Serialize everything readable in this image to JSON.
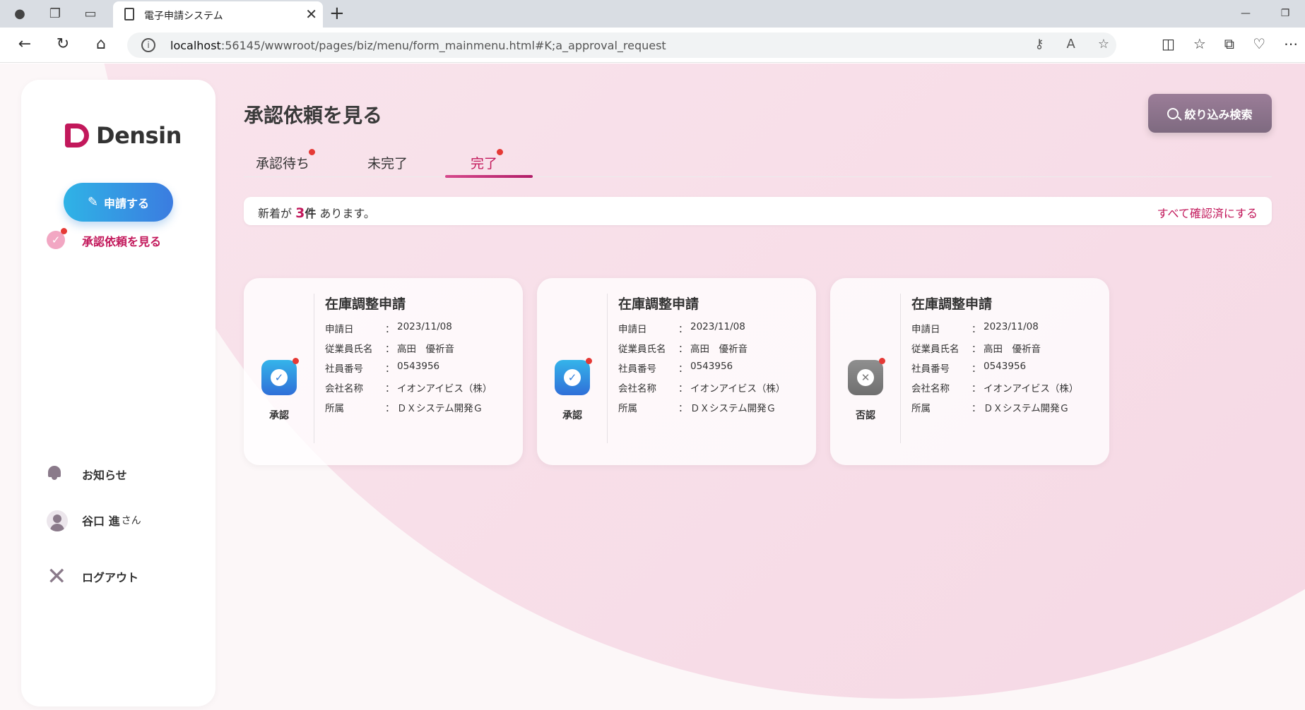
{
  "browser": {
    "tab_title": "電子申請システム",
    "url_host": "localhost",
    "url_rest": ":56145/wwwroot/pages/biz/menu/form_mainmenu.html#K;a_approval_request"
  },
  "sidebar": {
    "logo_text": "Densin",
    "apply_button": "申請する",
    "nav_approval": "承認依頼を見る",
    "notifications": "お知らせ",
    "user_name": "谷口 進",
    "user_suffix": "さん",
    "logout": "ログアウト"
  },
  "main": {
    "title": "承認依頼を見る",
    "filter_button": "絞り込み検索",
    "tabs": [
      {
        "label": "承認待ち",
        "badge": true
      },
      {
        "label": "未完了",
        "badge": false
      },
      {
        "label": "完了",
        "badge": true,
        "active": true
      }
    ],
    "notice": {
      "prefix": "新着が ",
      "count": "3",
      "unit": "件",
      "suffix": " あります。",
      "mark_all": "すべて確認済にする"
    },
    "field_labels": {
      "date": "申請日",
      "name": "従業員氏名",
      "number": "社員番号",
      "company": "会社名称",
      "dept": "所属",
      "colon": "："
    },
    "cards": [
      {
        "title": "在庫調整申請",
        "status": "承認",
        "status_type": "approved",
        "date": "2023/11/08",
        "name": "高田　優祈音",
        "number": "0543956",
        "company": "イオンアイビス（株）",
        "dept": "ＤＸシステム開発Ｇ"
      },
      {
        "title": "在庫調整申請",
        "status": "承認",
        "status_type": "approved",
        "date": "2023/11/08",
        "name": "高田　優祈音",
        "number": "0543956",
        "company": "イオンアイビス（株）",
        "dept": "ＤＸシステム開発Ｇ"
      },
      {
        "title": "在庫調整申請",
        "status": "否認",
        "status_type": "rejected",
        "date": "2023/11/08",
        "name": "高田　優祈音",
        "number": "0543956",
        "company": "イオンアイビス（株）",
        "dept": "ＤＸシステム開発Ｇ"
      }
    ]
  },
  "colors": {
    "accent": "#c2185b",
    "approve": "#2f7ddb",
    "reject": "#7a7a7a"
  }
}
